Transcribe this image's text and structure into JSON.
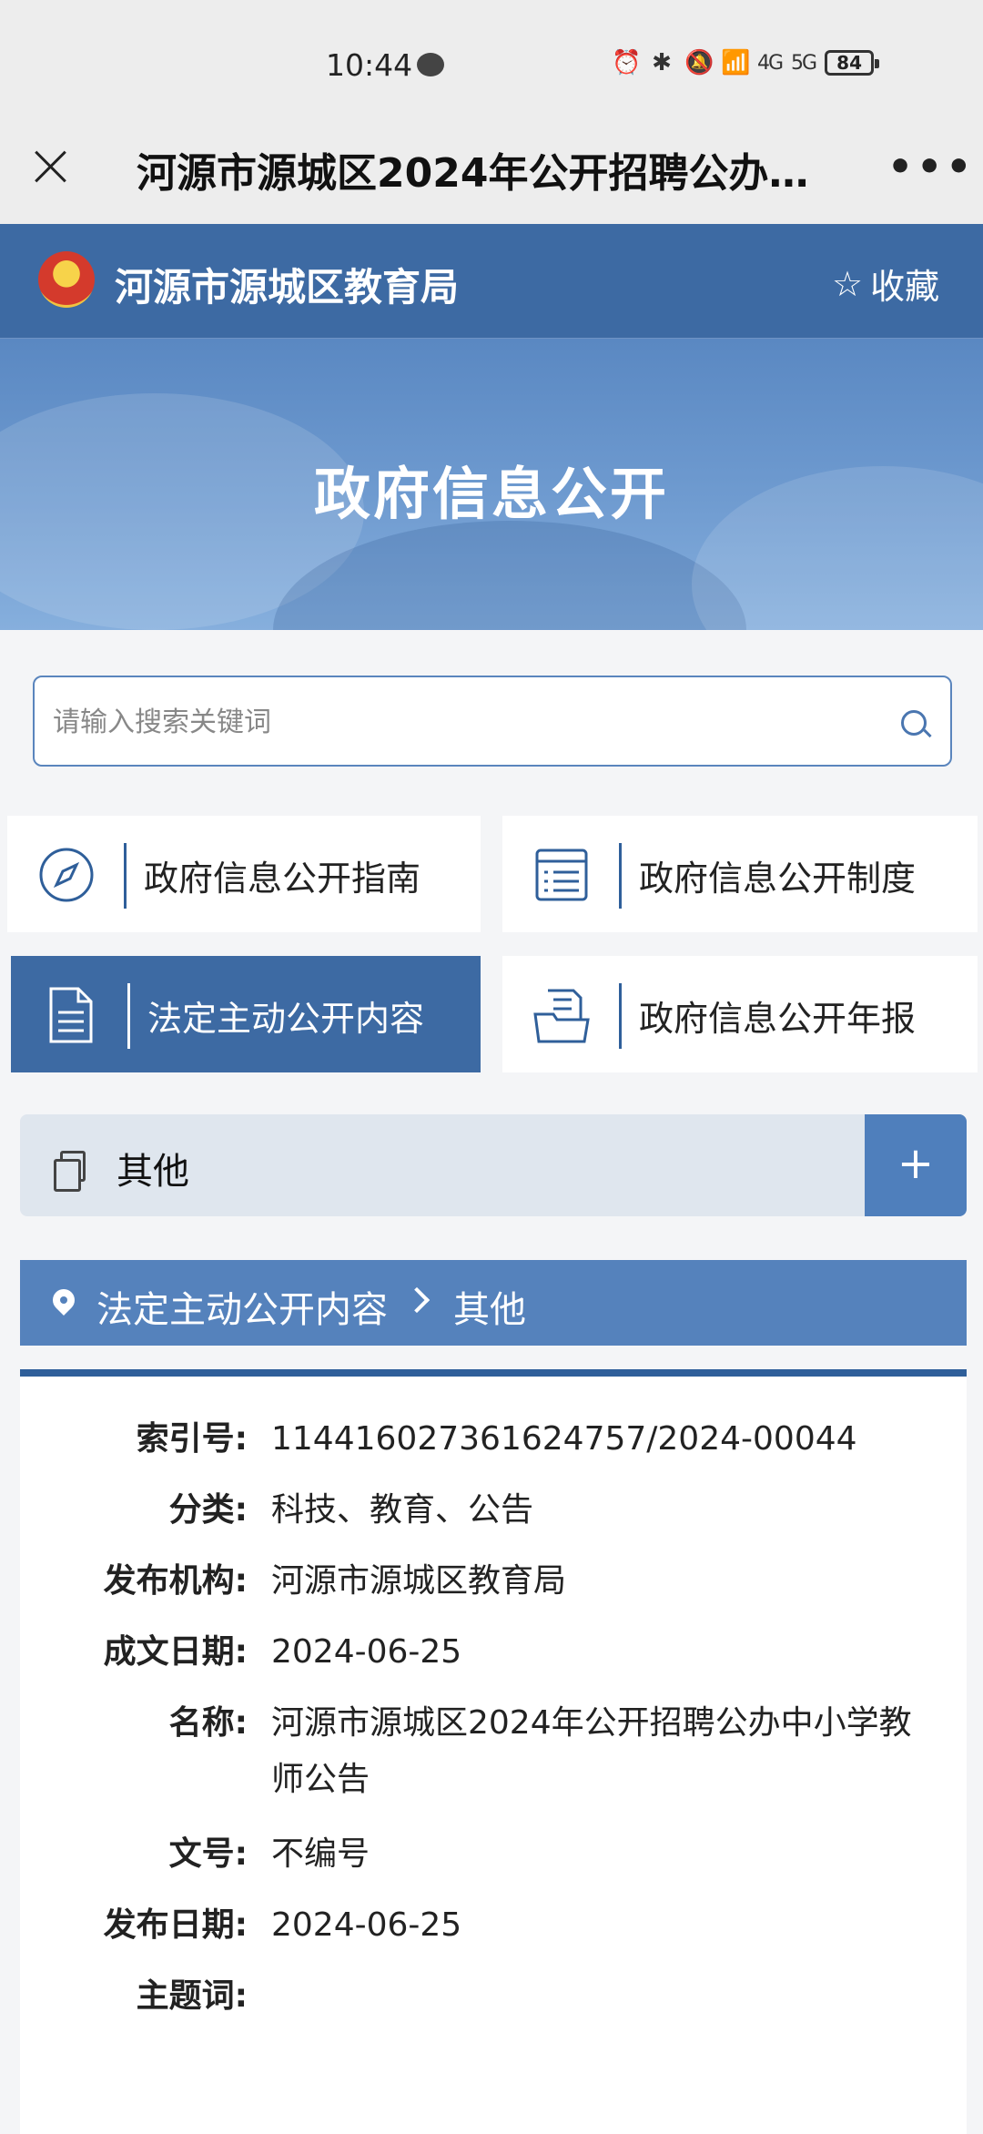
{
  "status_bar": {
    "time": "10:44",
    "signal1": "4G",
    "signal2": "5G",
    "battery": "84"
  },
  "nav": {
    "title": "河源市源城区2024年公开招聘公办…",
    "more": "•••"
  },
  "site": {
    "name": "河源市源城区教育局",
    "favorite": "收藏",
    "hero_title": "政府信息公开"
  },
  "search": {
    "placeholder": "请输入搜索关键词",
    "value": ""
  },
  "tiles": [
    {
      "label": "政府信息公开指南",
      "icon": "compass-icon",
      "active": false
    },
    {
      "label": "政府信息公开制度",
      "icon": "list-document-icon",
      "active": false
    },
    {
      "label": "法定主动公开内容",
      "icon": "document-icon",
      "active": true
    },
    {
      "label": "政府信息公开年报",
      "icon": "folder-document-icon",
      "active": false
    }
  ],
  "category": {
    "label": "其他",
    "expand": "+"
  },
  "breadcrumb": {
    "level1": "法定主动公开内容",
    "level2": "其他"
  },
  "info": [
    {
      "key": "索引号:",
      "value": "11441602736162475​7/2024-00044"
    },
    {
      "key": "分类:",
      "value": "科技、教育、公告"
    },
    {
      "key": "发布机构:",
      "value": "河源市源城区教育局"
    },
    {
      "key": "成文日期:",
      "value": "2024-06-25"
    },
    {
      "key": "名称:",
      "value": "河源市源城区2024年公开招聘公办中小学教师公告"
    },
    {
      "key": "文号:",
      "value": "不编号"
    },
    {
      "key": "发布日期:",
      "value": "2024-06-25"
    },
    {
      "key": "主题词:",
      "value": ""
    }
  ],
  "colors": {
    "primary": "#3d6aa3",
    "breadcrumb": "#5582bc",
    "accent_dark": "#2f5f9a"
  }
}
